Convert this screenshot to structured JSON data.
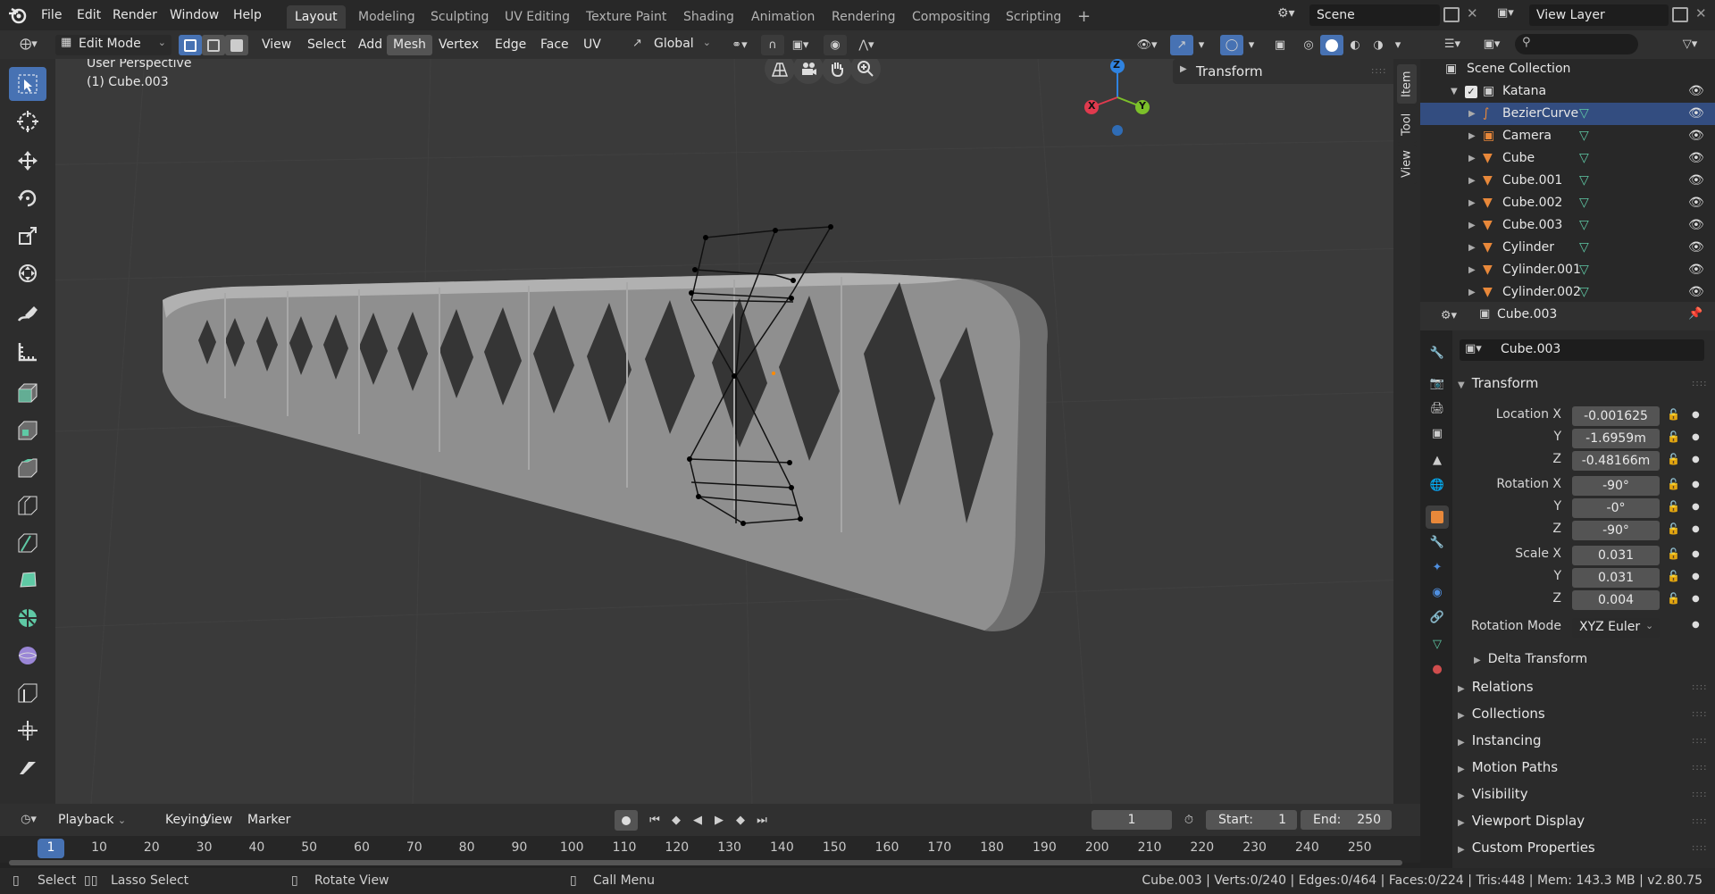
{
  "topbar": {
    "menus": [
      "File",
      "Edit",
      "Render",
      "Window",
      "Help"
    ],
    "workspaces": [
      "Layout",
      "Modeling",
      "Sculpting",
      "UV Editing",
      "Texture Paint",
      "Shading",
      "Animation",
      "Rendering",
      "Compositing",
      "Scripting"
    ],
    "active_workspace": "Layout",
    "scene": "Scene",
    "view_layer": "View Layer"
  },
  "viewport_header": {
    "mode": "Edit Mode",
    "menus": [
      "View",
      "Select",
      "Add",
      "Mesh",
      "Vertex",
      "Edge",
      "Face",
      "UV"
    ],
    "orientation": "Global"
  },
  "viewport": {
    "perspective_label": "User Perspective",
    "object_label": "(1) Cube.003",
    "gizmo_x": "X",
    "gizmo_y": "Y",
    "gizmo_z": "Z",
    "npanel_title": "Transform",
    "side_tabs": [
      "Item",
      "Tool",
      "View"
    ]
  },
  "outliner": {
    "collection": "Scene Collection",
    "group": "Katana",
    "items": [
      {
        "name": "BezierCurve",
        "selected": true
      },
      {
        "name": "Camera",
        "selected": false
      },
      {
        "name": "Cube",
        "selected": false
      },
      {
        "name": "Cube.001",
        "selected": false
      },
      {
        "name": "Cube.002",
        "selected": false
      },
      {
        "name": "Cube.003",
        "selected": false
      },
      {
        "name": "Cylinder",
        "selected": false
      },
      {
        "name": "Cylinder.001",
        "selected": false
      },
      {
        "name": "Cylinder.002",
        "selected": false
      }
    ]
  },
  "properties": {
    "header_object": "Cube.003",
    "object_name": "Cube.003",
    "transform_title": "Transform",
    "location_label": "Location X",
    "rotation_label": "Rotation X",
    "scale_label": "Scale X",
    "y_label": "Y",
    "z_label": "Z",
    "location": [
      "-0.001625",
      "-1.6959m",
      "-0.48166m"
    ],
    "rotation": [
      "-90°",
      "-0°",
      "-90°"
    ],
    "scale": [
      "0.031",
      "0.031",
      "0.004"
    ],
    "rotation_mode_label": "Rotation Mode",
    "rotation_mode": "XYZ Euler",
    "delta_transform": "Delta Transform",
    "sections": [
      "Relations",
      "Collections",
      "Instancing",
      "Motion Paths",
      "Visibility",
      "Viewport Display",
      "Custom Properties"
    ]
  },
  "timeline": {
    "menus": [
      "Playback",
      "Keying",
      "View",
      "Marker"
    ],
    "current_frame": "1",
    "start_label": "Start:",
    "start": "1",
    "end_label": "End:",
    "end": "250",
    "ticks": [
      "1",
      "10",
      "20",
      "30",
      "40",
      "50",
      "60",
      "70",
      "80",
      "90",
      "100",
      "110",
      "120",
      "130",
      "140",
      "150",
      "160",
      "170",
      "180",
      "190",
      "200",
      "210",
      "220",
      "230",
      "240",
      "250"
    ]
  },
  "statusbar": {
    "select": "Select",
    "lasso": "Lasso Select",
    "rotate": "Rotate View",
    "call_menu": "Call Menu",
    "stats": "Cube.003 | Verts:0/240 | Edges:0/464 | Faces:0/224 | Tris:448 | Mem: 143.3 MB | v2.80.75"
  },
  "colors": {
    "accent": "#4772b3",
    "selected_row": "#334d80",
    "mesh": "#9c9c9c",
    "object_orange": "#e8883a",
    "mesh_green": "#5fc9a5"
  }
}
